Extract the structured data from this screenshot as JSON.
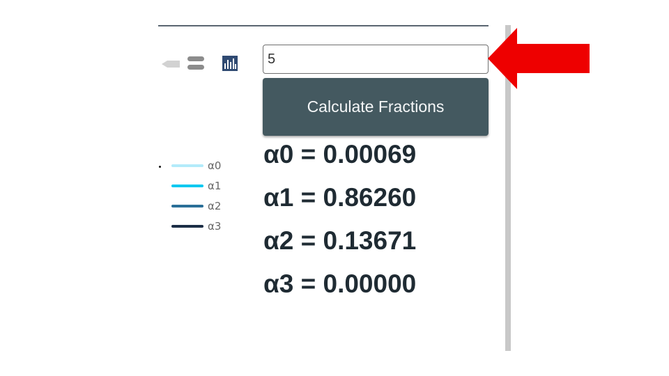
{
  "toolbar": {
    "icons": [
      "minus-icon",
      "equals-icon",
      "bar-chart-icon"
    ]
  },
  "legend": {
    "items": [
      {
        "label": "α0",
        "color": "#b3ebfa"
      },
      {
        "label": "α1",
        "color": "#00c8f0"
      },
      {
        "label": "α2",
        "color": "#2a6f98"
      },
      {
        "label": "α3",
        "color": "#1c2e46"
      }
    ]
  },
  "input": {
    "value": "5"
  },
  "button": {
    "label": "Calculate Fractions",
    "color": "#445960"
  },
  "results": [
    "α0 = 0.00069",
    "α1 = 0.86260",
    "α2 = 0.13671",
    "α3 = 0.00000"
  ],
  "annotation": {
    "arrow_color": "#ee0000"
  }
}
